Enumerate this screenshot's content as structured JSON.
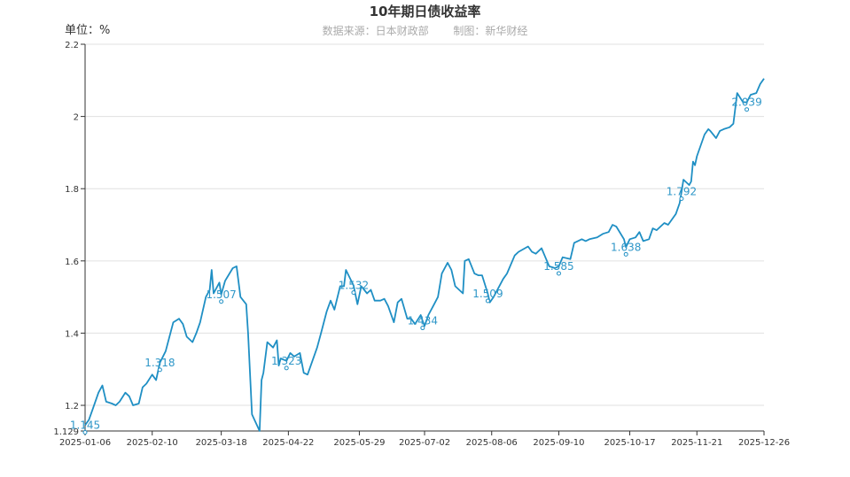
{
  "chart_data": {
    "type": "line",
    "title": "10年期日债收益率",
    "subtitle_source": "数据来源：日本财政部",
    "subtitle_maker": "制图：新华财经",
    "unit_label": "单位：%",
    "ylim": [
      1.129,
      2.2
    ],
    "y_ticks": [
      1.129,
      1.2,
      1.4,
      1.6,
      1.8,
      2,
      2.2
    ],
    "y_tick_labels": [
      "1.129",
      "1.2",
      "1.4",
      "1.6",
      "1.8",
      "2",
      "2.2"
    ],
    "x_ticks": [
      "2025-01-06",
      "2025-02-10",
      "2025-03-18",
      "2025-04-22",
      "2025-05-29",
      "2025-07-02",
      "2025-08-06",
      "2025-09-10",
      "2025-10-17",
      "2025-11-21",
      "2025-12-26"
    ],
    "grid": true,
    "line_color": "#1f8fc4",
    "series": [
      {
        "points": [
          [
            "2025-01-06",
            1.145
          ],
          [
            "2025-01-08",
            1.16
          ],
          [
            "2025-01-10",
            1.19
          ],
          [
            "2025-01-13",
            1.235
          ],
          [
            "2025-01-15",
            1.255
          ],
          [
            "2025-01-17",
            1.21
          ],
          [
            "2025-01-20",
            1.205
          ],
          [
            "2025-01-22",
            1.2
          ],
          [
            "2025-01-24",
            1.21
          ],
          [
            "2025-01-27",
            1.235
          ],
          [
            "2025-01-29",
            1.225
          ],
          [
            "2025-01-31",
            1.2
          ],
          [
            "2025-02-03",
            1.205
          ],
          [
            "2025-02-05",
            1.25
          ],
          [
            "2025-02-07",
            1.26
          ],
          [
            "2025-02-10",
            1.285
          ],
          [
            "2025-02-12",
            1.27
          ],
          [
            "2025-02-14",
            1.318
          ],
          [
            "2025-02-17",
            1.35
          ],
          [
            "2025-02-19",
            1.39
          ],
          [
            "2025-02-21",
            1.43
          ],
          [
            "2025-02-24",
            1.44
          ],
          [
            "2025-02-26",
            1.425
          ],
          [
            "2025-02-28",
            1.39
          ],
          [
            "2025-03-03",
            1.375
          ],
          [
            "2025-03-05",
            1.4
          ],
          [
            "2025-03-07",
            1.43
          ],
          [
            "2025-03-10",
            1.5
          ],
          [
            "2025-03-12",
            1.52
          ],
          [
            "2025-03-13",
            1.575
          ],
          [
            "2025-03-14",
            1.51
          ],
          [
            "2025-03-17",
            1.54
          ],
          [
            "2025-03-18",
            1.507
          ],
          [
            "2025-03-20",
            1.545
          ],
          [
            "2025-03-24",
            1.58
          ],
          [
            "2025-03-26",
            1.585
          ],
          [
            "2025-03-28",
            1.5
          ],
          [
            "2025-03-31",
            1.48
          ],
          [
            "2025-04-01",
            1.4
          ],
          [
            "2025-04-03",
            1.175
          ],
          [
            "2025-04-07",
            1.129
          ],
          [
            "2025-04-08",
            1.27
          ],
          [
            "2025-04-09",
            1.29
          ],
          [
            "2025-04-11",
            1.375
          ],
          [
            "2025-04-14",
            1.36
          ],
          [
            "2025-04-16",
            1.38
          ],
          [
            "2025-04-17",
            1.31
          ],
          [
            "2025-04-18",
            1.33
          ],
          [
            "2025-04-21",
            1.323
          ],
          [
            "2025-04-23",
            1.345
          ],
          [
            "2025-04-25",
            1.335
          ],
          [
            "2025-04-28",
            1.345
          ],
          [
            "2025-04-30",
            1.29
          ],
          [
            "2025-05-02",
            1.285
          ],
          [
            "2025-05-07",
            1.36
          ],
          [
            "2025-05-09",
            1.4
          ],
          [
            "2025-05-12",
            1.46
          ],
          [
            "2025-05-14",
            1.49
          ],
          [
            "2025-05-16",
            1.465
          ],
          [
            "2025-05-19",
            1.53
          ],
          [
            "2025-05-21",
            1.53
          ],
          [
            "2025-05-22",
            1.575
          ],
          [
            "2025-05-26",
            1.532
          ],
          [
            "2025-05-28",
            1.48
          ],
          [
            "2025-05-30",
            1.53
          ],
          [
            "2025-06-02",
            1.51
          ],
          [
            "2025-06-04",
            1.52
          ],
          [
            "2025-06-06",
            1.49
          ],
          [
            "2025-06-09",
            1.49
          ],
          [
            "2025-06-11",
            1.495
          ],
          [
            "2025-06-13",
            1.475
          ],
          [
            "2025-06-16",
            1.43
          ],
          [
            "2025-06-18",
            1.485
          ],
          [
            "2025-06-20",
            1.495
          ],
          [
            "2025-06-23",
            1.44
          ],
          [
            "2025-06-25",
            1.44
          ],
          [
            "2025-06-27",
            1.425
          ],
          [
            "2025-06-30",
            1.45
          ],
          [
            "2025-07-01",
            1.434
          ],
          [
            "2025-07-02",
            1.42
          ],
          [
            "2025-07-04",
            1.45
          ],
          [
            "2025-07-07",
            1.48
          ],
          [
            "2025-07-09",
            1.5
          ],
          [
            "2025-07-11",
            1.565
          ],
          [
            "2025-07-14",
            1.595
          ],
          [
            "2025-07-16",
            1.575
          ],
          [
            "2025-07-18",
            1.53
          ],
          [
            "2025-07-22",
            1.51
          ],
          [
            "2025-07-23",
            1.6
          ],
          [
            "2025-07-25",
            1.605
          ],
          [
            "2025-07-28",
            1.565
          ],
          [
            "2025-07-30",
            1.56
          ],
          [
            "2025-08-01",
            1.56
          ],
          [
            "2025-08-04",
            1.509
          ],
          [
            "2025-08-05",
            1.485
          ],
          [
            "2025-08-07",
            1.5
          ],
          [
            "2025-08-12",
            1.55
          ],
          [
            "2025-08-14",
            1.565
          ],
          [
            "2025-08-18",
            1.615
          ],
          [
            "2025-08-20",
            1.625
          ],
          [
            "2025-08-25",
            1.64
          ],
          [
            "2025-08-27",
            1.625
          ],
          [
            "2025-08-29",
            1.62
          ],
          [
            "2025-09-01",
            1.635
          ],
          [
            "2025-09-03",
            1.61
          ],
          [
            "2025-09-05",
            1.585
          ],
          [
            "2025-09-08",
            1.58
          ],
          [
            "2025-09-10",
            1.585
          ],
          [
            "2025-09-12",
            1.61
          ],
          [
            "2025-09-16",
            1.605
          ],
          [
            "2025-09-18",
            1.65
          ],
          [
            "2025-09-22",
            1.66
          ],
          [
            "2025-09-24",
            1.655
          ],
          [
            "2025-09-26",
            1.66
          ],
          [
            "2025-09-30",
            1.665
          ],
          [
            "2025-10-03",
            1.675
          ],
          [
            "2025-10-06",
            1.68
          ],
          [
            "2025-10-08",
            1.7
          ],
          [
            "2025-10-10",
            1.695
          ],
          [
            "2025-10-14",
            1.66
          ],
          [
            "2025-10-15",
            1.638
          ],
          [
            "2025-10-17",
            1.66
          ],
          [
            "2025-10-20",
            1.665
          ],
          [
            "2025-10-22",
            1.68
          ],
          [
            "2025-10-24",
            1.655
          ],
          [
            "2025-10-27",
            1.66
          ],
          [
            "2025-10-29",
            1.69
          ],
          [
            "2025-10-31",
            1.685
          ],
          [
            "2025-11-04",
            1.705
          ],
          [
            "2025-11-06",
            1.7
          ],
          [
            "2025-11-10",
            1.73
          ],
          [
            "2025-11-12",
            1.76
          ],
          [
            "2025-11-13",
            1.792
          ],
          [
            "2025-11-14",
            1.825
          ],
          [
            "2025-11-17",
            1.81
          ],
          [
            "2025-11-18",
            1.82
          ],
          [
            "2025-11-19",
            1.875
          ],
          [
            "2025-11-20",
            1.865
          ],
          [
            "2025-11-21",
            1.89
          ],
          [
            "2025-11-25",
            1.95
          ],
          [
            "2025-11-27",
            1.965
          ],
          [
            "2025-11-28",
            1.96
          ],
          [
            "2025-12-01",
            1.94
          ],
          [
            "2025-12-03",
            1.96
          ],
          [
            "2025-12-05",
            1.965
          ],
          [
            "2025-12-08",
            1.97
          ],
          [
            "2025-12-10",
            1.98
          ],
          [
            "2025-12-12",
            2.065
          ],
          [
            "2025-12-15",
            2.04
          ],
          [
            "2025-12-17",
            2.039
          ],
          [
            "2025-12-19",
            2.06
          ],
          [
            "2025-12-22",
            2.065
          ],
          [
            "2025-12-24",
            2.09
          ],
          [
            "2025-12-26",
            2.105
          ]
        ]
      }
    ],
    "annotations": [
      {
        "x": "2025-01-06",
        "y": 1.145,
        "label": "1.145"
      },
      {
        "x": "2025-02-14",
        "y": 1.318,
        "label": "1.318"
      },
      {
        "x": "2025-03-18",
        "y": 1.507,
        "label": "1.507"
      },
      {
        "x": "2025-04-21",
        "y": 1.323,
        "label": "1.323"
      },
      {
        "x": "2025-05-26",
        "y": 1.532,
        "label": "1.532"
      },
      {
        "x": "2025-07-01",
        "y": 1.434,
        "label": "1.434"
      },
      {
        "x": "2025-08-04",
        "y": 1.509,
        "label": "1.509"
      },
      {
        "x": "2025-09-10",
        "y": 1.585,
        "label": "1.585"
      },
      {
        "x": "2025-10-15",
        "y": 1.638,
        "label": "1.638"
      },
      {
        "x": "2025-11-13",
        "y": 1.792,
        "label": "1.792"
      },
      {
        "x": "2025-12-17",
        "y": 2.039,
        "label": "2.039"
      }
    ]
  }
}
